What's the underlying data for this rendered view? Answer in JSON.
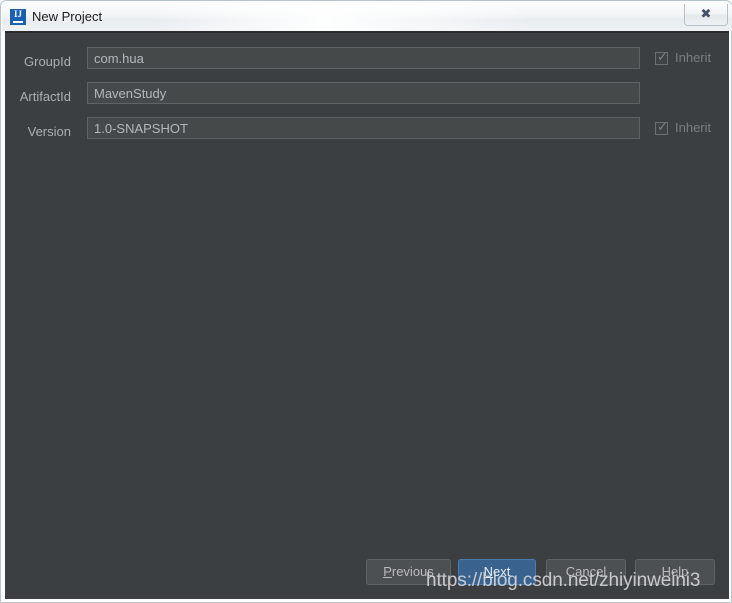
{
  "window": {
    "title": "New Project",
    "app_icon": "intellij-idea-icon",
    "icon_letters": "IJ",
    "close_label": "✖",
    "close_icon": "close-icon"
  },
  "form": {
    "rows": [
      {
        "label": "GroupId",
        "value": "com.hua",
        "placeholder": "",
        "inherit": {
          "label": "Inherit",
          "checked": true,
          "mark": "✓"
        }
      },
      {
        "label": "ArtifactId",
        "value": "MavenStudy",
        "placeholder": "",
        "inherit": null
      },
      {
        "label": "Version",
        "value": "1.0-SNAPSHOT",
        "placeholder": "",
        "inherit": {
          "label": "Inherit",
          "checked": true,
          "mark": "✓"
        }
      }
    ]
  },
  "buttons": {
    "previous": {
      "mnemonic": "P",
      "rest": "revious"
    },
    "next": {
      "mnemonic": "N",
      "rest": "ext"
    },
    "cancel": {
      "label": "Cancel"
    },
    "help": {
      "label": "Help"
    }
  },
  "watermark": {
    "text": "https://blog.csdn.net/zhiyinweini3"
  },
  "colors": {
    "dialog_background": "#3c3f41",
    "field_background": "#45494a",
    "primary_button": "#3a628f",
    "title_text": "#1b1b1b",
    "label_text": "#a9b0b4"
  }
}
